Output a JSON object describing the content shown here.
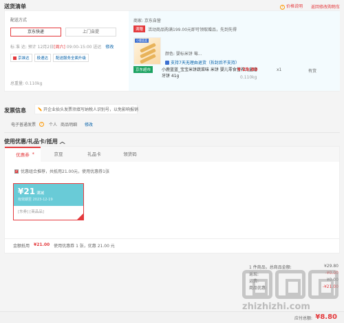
{
  "header": {
    "title": "送货清单",
    "price_note": "价格说明",
    "back_to_cart": "返回修改购物车"
  },
  "shipping": {
    "method_label": "配送方式",
    "options": [
      "京东快递",
      "上门自提"
    ],
    "time_label": "标  准  达:",
    "time_prefix": "预计 12月2日",
    "time_weekday": "[周六]",
    "time_range": "09:00-15:00 送达",
    "time_edit": "修改",
    "services": [
      "京准达",
      "极速达",
      "配送服务全面升级"
    ],
    "total_weight": "总重量: 0.110kg"
  },
  "store": {
    "label": "商家: 京东自营",
    "promo_badge": "满赠",
    "promo_text": "活动商品购满199.00元即可领取赠品，先到先得",
    "color_attr": "颜色: 婴标米饼 莓...",
    "return_policy": "支持7天无理由退货（拆封后不支持）",
    "channel_badge": "京东超市",
    "product_name": "小鹿蓝蓝_宝宝米饼蔬菜味 米饼 婴儿零食营养儿童磨牙饼 41g",
    "price": "¥ 29.80",
    "qty": "x1",
    "stock": "有货",
    "weight": "0.110kg",
    "image_tag": "小鹿蓝蓝"
  },
  "invoice": {
    "title": "发票信息",
    "note": "开企业抬头发票须填写纳税人识别号，以免影响报销",
    "type": "电子普通发票",
    "holder": "个人",
    "content": "商品明细",
    "edit": "修改"
  },
  "coupons": {
    "title": "使用优惠/礼品卡/抵用",
    "tabs": [
      "优惠券",
      "京豆",
      "礼品卡",
      "领货码"
    ],
    "tab_star": "*",
    "recommend": "优惠组合推荐，共抵用21.00元，使用优惠券1张",
    "card": {
      "amount": "¥21",
      "condition": "满减",
      "expiry": "有效期至 2023-12-19",
      "limit": "[东券]",
      "scope": "[商品品]"
    },
    "summary_label": "金额抵用",
    "summary_amount": "¥21.00",
    "summary_detail": "使用优惠券 1 张，优惠 21.00 元"
  },
  "totals": {
    "rows": [
      {
        "label": "1 件商品，总商品金额:",
        "value": "¥29.80",
        "red": false
      },
      {
        "label": "返现:",
        "value": "-¥0.00",
        "red": true
      },
      {
        "label": "运费:",
        "value": "¥0.00",
        "red": false
      },
      {
        "label": "商品优惠:",
        "value": "-¥21.00",
        "red": true
      }
    ],
    "pay_label": "应付总额:",
    "pay_amount": "¥8.80"
  },
  "watermark": {
    "text": "zhizhizhi.com"
  },
  "colors": {
    "accent": "#e4393c",
    "link": "#005ea7",
    "coupon": "#69cbd7",
    "panel": "#f3fbfe"
  }
}
